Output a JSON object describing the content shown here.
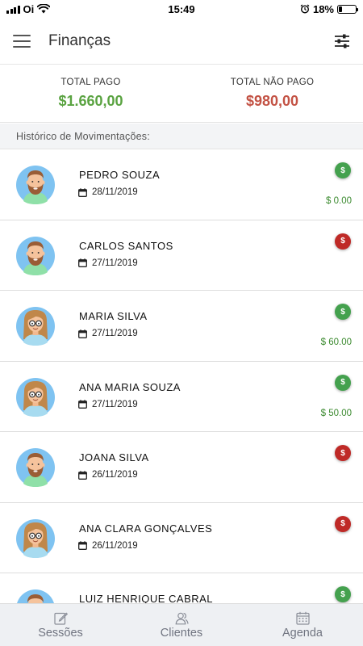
{
  "status_bar": {
    "carrier": "Oi",
    "time": "15:49",
    "battery": "18%",
    "battery_level": 0.18
  },
  "app_bar": {
    "title": "Finanças"
  },
  "summary": {
    "paid_label": "TOTAL PAGO",
    "paid_value": "$1.660,00",
    "unpaid_label": "TOTAL NÃO PAGO",
    "unpaid_value": "$980,00"
  },
  "history": {
    "header": "Histórico de Movimentações:",
    "items": [
      {
        "name": "PEDRO SOUZA",
        "date": "28/11/2019",
        "status": "paid",
        "amount": "$ 0.00",
        "avatar": "male"
      },
      {
        "name": "CARLOS SANTOS",
        "date": "27/11/2019",
        "status": "unpaid",
        "amount": "",
        "avatar": "male"
      },
      {
        "name": "MARIA SILVA",
        "date": "27/11/2019",
        "status": "paid",
        "amount": "$ 60.00",
        "avatar": "female"
      },
      {
        "name": "ANA MARIA SOUZA",
        "date": "27/11/2019",
        "status": "paid",
        "amount": "$ 50.00",
        "avatar": "female"
      },
      {
        "name": "JOANA SILVA",
        "date": "26/11/2019",
        "status": "unpaid",
        "amount": "",
        "avatar": "male"
      },
      {
        "name": "ANA CLARA GONÇALVES",
        "date": "26/11/2019",
        "status": "unpaid",
        "amount": "",
        "avatar": "female"
      },
      {
        "name": "LUIZ HENRIQUE CABRAL",
        "date": "",
        "status": "paid",
        "amount": "",
        "avatar": "male"
      }
    ]
  },
  "pay_icon_symbol": "$",
  "bottom_nav": [
    {
      "label": "Sessões",
      "icon": "edit-icon"
    },
    {
      "label": "Clientes",
      "icon": "users-icon"
    },
    {
      "label": "Agenda",
      "icon": "calendar-icon"
    }
  ],
  "colors": {
    "paid_total": "#5aa341",
    "unpaid_total": "#c35244",
    "paid_badge": "#44a14e",
    "unpaid_badge": "#bf2a27"
  }
}
